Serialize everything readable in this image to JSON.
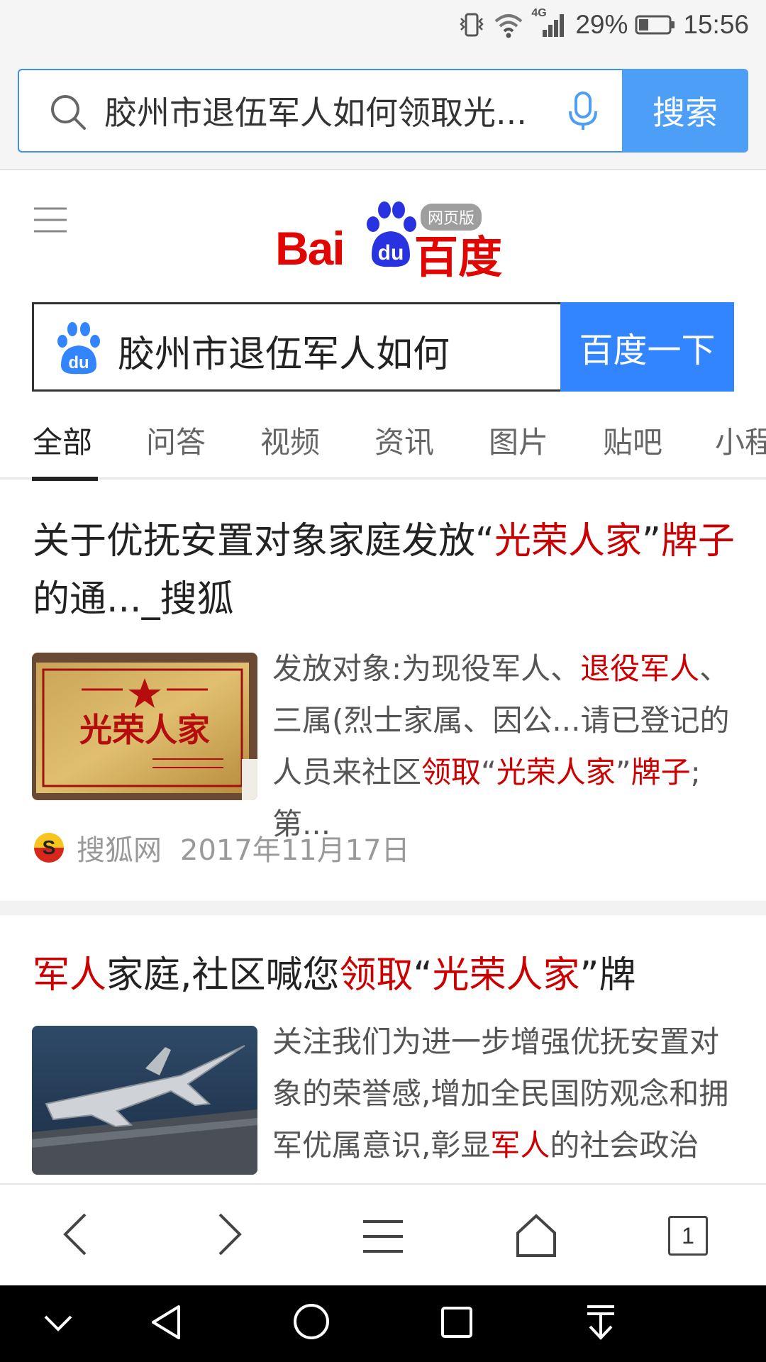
{
  "status_bar": {
    "battery_percent": "29%",
    "time": "15:56",
    "network_label": "4G"
  },
  "browser": {
    "query": "胶州市退伍军人如何领取光...",
    "search_button": "搜索"
  },
  "baidu": {
    "logo_bai": "Bai",
    "logo_du": "du",
    "logo_cn": "百度",
    "badge": "网页版",
    "query": "胶州市退伍军人如何",
    "search_button": "百度一下"
  },
  "tabs": [
    {
      "label": "全部",
      "active": true
    },
    {
      "label": "问答"
    },
    {
      "label": "视频"
    },
    {
      "label": "资讯"
    },
    {
      "label": "图片"
    },
    {
      "label": "贴吧"
    },
    {
      "label": "小程"
    }
  ],
  "results": [
    {
      "title_parts": [
        "关于优抚安置对象家庭发放“",
        "光荣人家",
        "”",
        "牌子",
        "的通..._搜狐"
      ],
      "snippet_parts": [
        "发放对象:为现役军人、",
        "退役军人",
        "、三属(烈士家属、因公...请已登记的人员来社区",
        "领取",
        "“",
        "光荣人家",
        "”",
        "牌子",
        ";第..."
      ],
      "thumb_text": "光荣人家",
      "source": "搜狐网",
      "date": "2017年11月17日"
    },
    {
      "title_parts": [
        "军人",
        "家庭,社区喊您",
        "领取",
        "“",
        "光荣人家",
        "”牌"
      ],
      "snippet_parts": [
        "关注我们为进一步增强优抚安置对象的荣誉感,增加全民国防观念和拥军优属意识,彰显",
        "军人",
        "的社会政治地.."
      ]
    }
  ],
  "toolbar": {
    "tab_count": "1"
  },
  "colors": {
    "accent_blue": "#3385ff",
    "highlight_red": "#cc0000",
    "baidu_red": "#e10601"
  }
}
